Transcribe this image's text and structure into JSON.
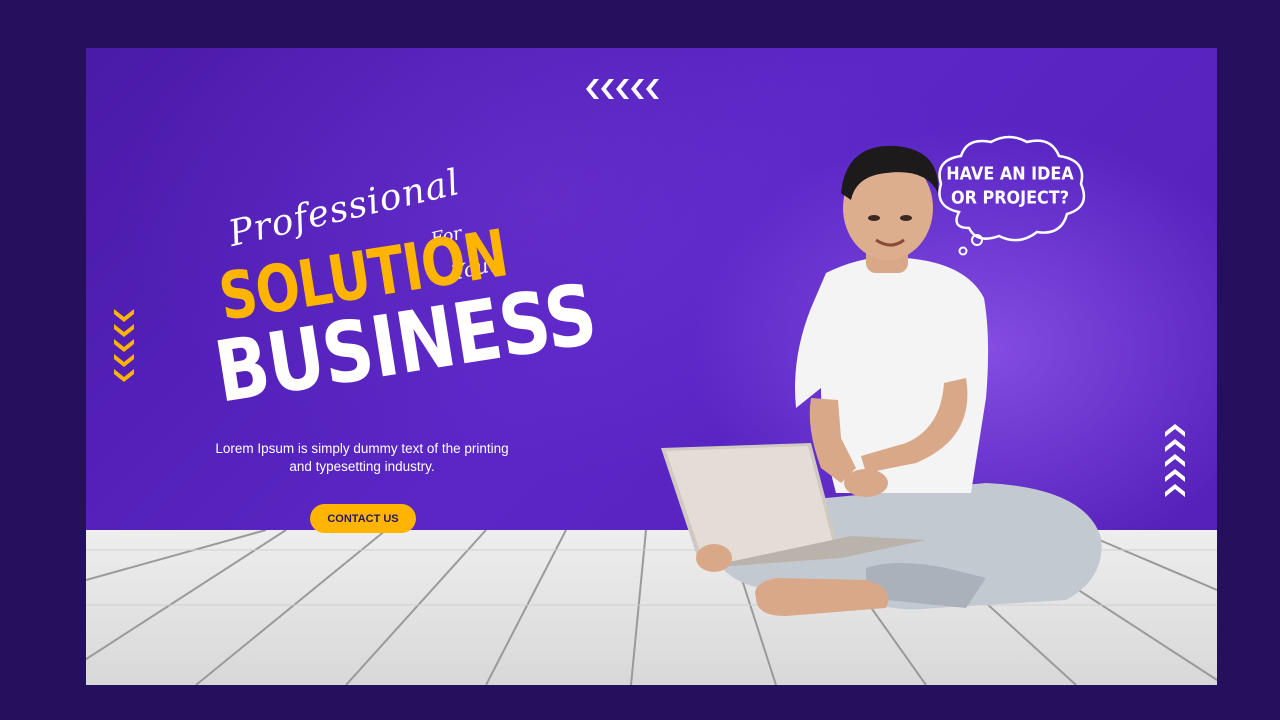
{
  "banner": {
    "script_professional": "Professional",
    "script_for": "For",
    "script_your": "Your",
    "headline_solution": "SOLUTION",
    "headline_business": "BUSINESS",
    "body_text": "Lorem Ipsum is simply dummy text of the printing and typesetting industry.",
    "cta_label": "CONTACT US",
    "bubble_line1": "HAVE AN IDEA",
    "bubble_line2": "OR PROJECT?"
  },
  "colors": {
    "page_background": "#24105c",
    "banner_purple": "#5a26c6",
    "accent_yellow": "#ffb400",
    "text_white": "#ffffff",
    "floor_white": "#eeeeee"
  },
  "icons": [
    "chevrons-left-icon",
    "chevrons-down-icon",
    "chevrons-up-icon",
    "thought-bubble-icon"
  ]
}
